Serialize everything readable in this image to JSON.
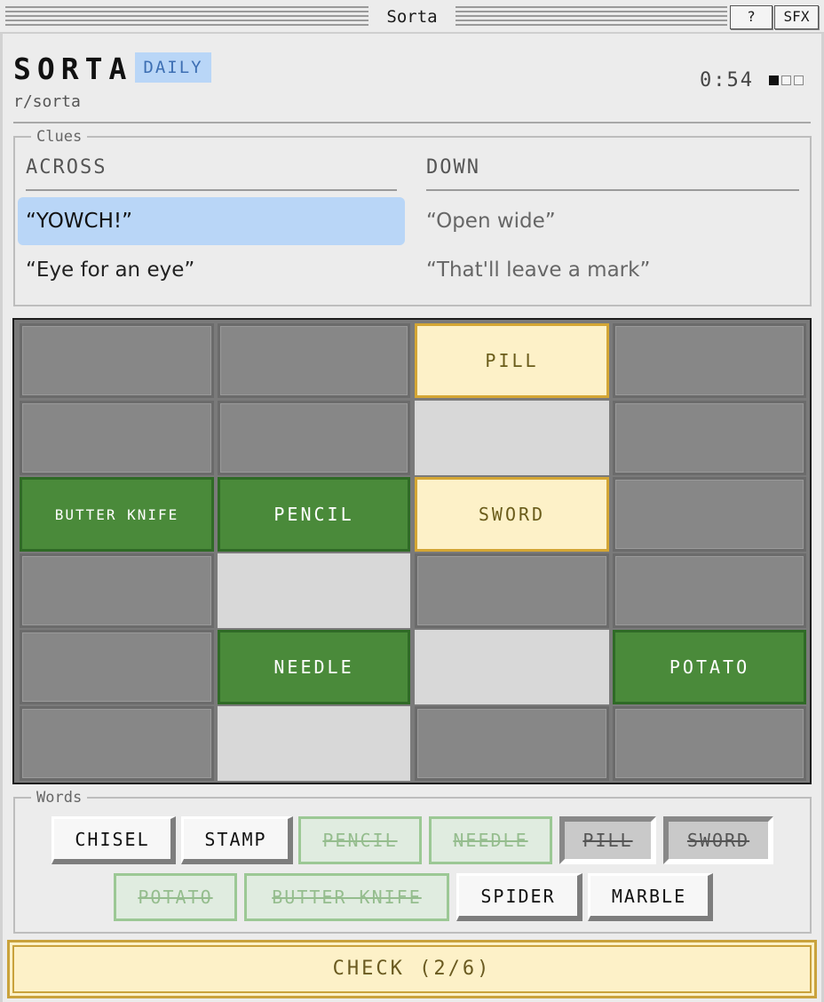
{
  "window": {
    "title": "Sorta",
    "help_label": "?",
    "sfx_label": "SFX"
  },
  "header": {
    "brand": "SORTA",
    "badge": "DAILY",
    "subreddit": "r/sorta",
    "timer": "0:54",
    "progress_filled": 1,
    "progress_total": 4
  },
  "clues": {
    "legend": "Clues",
    "across_label": "ACROSS",
    "down_label": "DOWN",
    "across": [
      "“YOWCH!”",
      "“Eye for an eye”"
    ],
    "down": [
      "“Open wide”",
      "“That'll leave a mark”"
    ],
    "active_clue": "across-0"
  },
  "grid": {
    "rows": 6,
    "cols": 4,
    "cells": [
      [
        "",
        "",
        "PILL",
        ""
      ],
      [
        "",
        "",
        "",
        ""
      ],
      [
        "BUTTER KNIFE",
        "PENCIL",
        "SWORD",
        ""
      ],
      [
        "",
        "",
        "",
        ""
      ],
      [
        "",
        "NEEDLE",
        "",
        "POTATO"
      ],
      [
        "",
        "",
        "",
        ""
      ]
    ]
  },
  "words": {
    "legend": "Words",
    "row1": [
      "CHISEL",
      "STAMP",
      "PENCIL",
      "NEEDLE",
      "PILL",
      "SWORD"
    ],
    "row2": [
      "POTATO",
      "BUTTER KNIFE",
      "SPIDER",
      "MARBLE"
    ]
  },
  "check_label": "CHECK (2/6)",
  "colors": {
    "correct": "#4a8a3a",
    "pending": "#fdf1c8",
    "highlight": "#b9d6f7"
  }
}
